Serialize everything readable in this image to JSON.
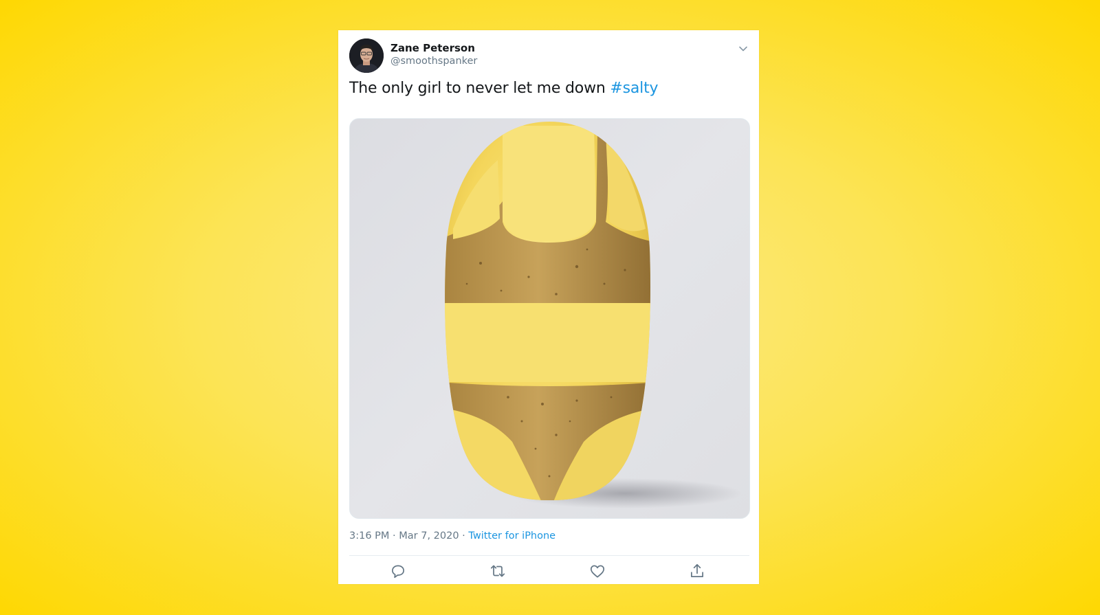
{
  "tweet": {
    "author_name": "Zane Peterson",
    "author_handle": "@smoothspanker",
    "text": "The only girl to never let me down ",
    "hashtag": "#salty",
    "time": "3:16 PM · Mar 7, 2020 · ",
    "source": "Twitter for iPhone"
  },
  "icons": {
    "menu": "chevron-down-icon",
    "reply": "reply-icon",
    "retweet": "retweet-icon",
    "like": "heart-icon",
    "share": "share-icon"
  },
  "colors": {
    "background": "#fed802",
    "link": "#1b95e0",
    "secondary_text": "#657786",
    "primary_text": "#14171a"
  }
}
